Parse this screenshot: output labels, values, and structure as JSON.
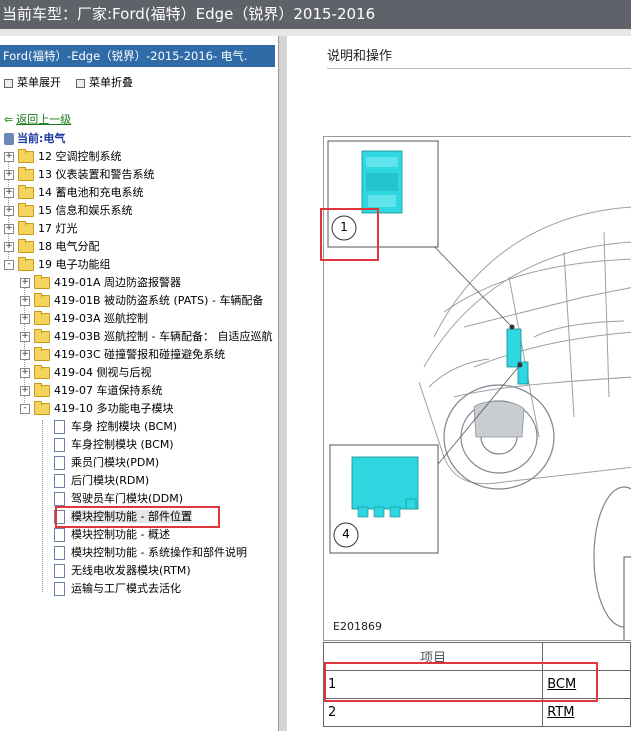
{
  "titlebar": {
    "text": "当前车型：厂家:Ford(福特）Edge（锐界）2015-2016"
  },
  "tree_header": "Ford(福特）-Edge（锐界）-2015-2016- 电气.",
  "menu": {
    "expand": "菜单展开",
    "collapse": "菜单折叠"
  },
  "back_link": "返回上一级",
  "current": "当前:电气",
  "tree": {
    "top_items": [
      {
        "label": "12 空调控制系统",
        "state": "+"
      },
      {
        "label": "13 仪表装置和警告系统",
        "state": "+"
      },
      {
        "label": "14 蓄电池和充电系统",
        "state": "+"
      },
      {
        "label": "15 信息和娱乐系统",
        "state": "+"
      },
      {
        "label": "17 灯光",
        "state": "+"
      },
      {
        "label": "18 电气分配",
        "state": "+"
      },
      {
        "label": "19 电子功能组",
        "state": "-"
      }
    ],
    "sub_items": [
      {
        "label": "419-01A 周边防盗报警器",
        "state": "+"
      },
      {
        "label": "419-01B 被动防盗系统 (PATS) - 车辆配备",
        "state": "+"
      },
      {
        "label": "419-03A 巡航控制",
        "state": "+"
      },
      {
        "label": "419-03B 巡航控制 - 车辆配备： 自适应巡航",
        "state": "+"
      },
      {
        "label": "419-03C 碰撞警报和碰撞避免系统",
        "state": "+"
      },
      {
        "label": "419-04 侧视与后视",
        "state": "+"
      },
      {
        "label": "419-07 车道保持系统",
        "state": "+"
      },
      {
        "label": "419-10 多功能电子模块",
        "state": "-"
      }
    ],
    "docs": [
      "车身 控制模块 (BCM)",
      "车身控制模块 (BCM)",
      "乘员门模块(PDM)",
      "后门模块(RDM)",
      "驾驶员车门模块(DDM)",
      "模块控制功能 - 部件位置",
      "模块控制功能 - 概述",
      "模块控制功能 - 系统操作和部件说明",
      "无线电收发器模块(RTM)",
      "运输与工厂模式去活化"
    ],
    "selected_doc": "模块控制功能 - 部件位置"
  },
  "right": {
    "title": "说明和操作",
    "callouts": [
      "1",
      "4"
    ],
    "figure_id": "E201869",
    "table": {
      "header": "项目",
      "rows": [
        {
          "item": "1",
          "name": "BCM"
        },
        {
          "item": "2",
          "name": "RTM"
        }
      ]
    }
  },
  "colors": {
    "titlebar": "#5f6268",
    "tree_header": "#2f6ba6",
    "module": "#2fd7e0",
    "highlight": "#e0353b"
  },
  "icons": [
    "collapse-icon",
    "expand-icon",
    "back-arrow-icon",
    "folder-icon",
    "document-icon",
    "car-icon"
  ]
}
